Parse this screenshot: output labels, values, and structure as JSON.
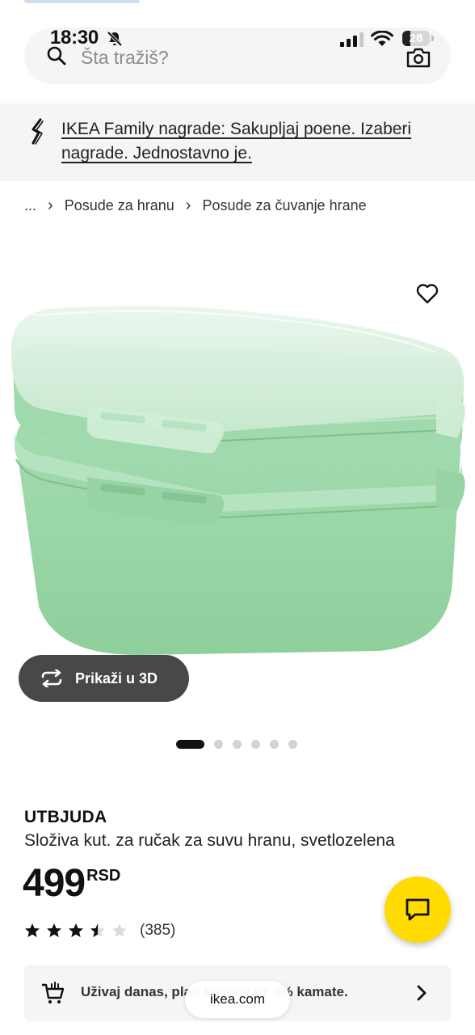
{
  "status_bar": {
    "time": "18:30",
    "battery": "28",
    "battery_level": 0.28
  },
  "search": {
    "placeholder": "Šta tražiš?"
  },
  "family_banner": {
    "text": "IKEA Family nagrade: Sakupljaj poene. Izaberi nagrade. Jednostavno je."
  },
  "breadcrumb": {
    "items": [
      "...",
      "Posude za hranu",
      "Posude za čuvanje hrane"
    ]
  },
  "product": {
    "view_3d_label": "Prikaži u 3D",
    "image_count": 6,
    "active_image": 1,
    "name": "UTBJUDA",
    "description": "Složiva kut. za ručak za suvu hranu, svetlozelena",
    "price": "499",
    "currency": "RSD",
    "rating": 3.5,
    "rating_count": "(385)"
  },
  "finance_banner": {
    "text": "Uživaj danas, plati kasnije uz 0% kamate."
  },
  "browser": {
    "url": "ikea.com"
  },
  "colors": {
    "accent_yellow": "#ffdb00",
    "product_green": "#9bd6a8",
    "button_dark": "#484848"
  },
  "icons": [
    "bell-slash-icon",
    "signal-icon",
    "wifi-icon",
    "search-icon",
    "camera-icon",
    "family-link-icon",
    "heart-icon",
    "rotate-3d-icon",
    "star-icon",
    "chat-icon",
    "cart-icon",
    "chevron-right-icon"
  ]
}
